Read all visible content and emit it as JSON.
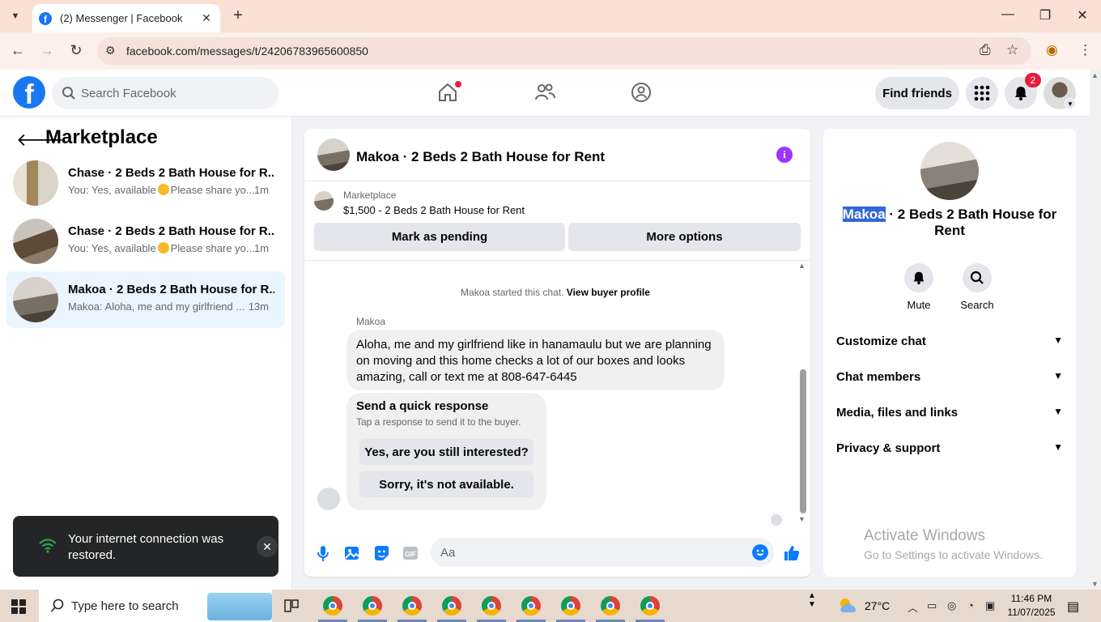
{
  "browser": {
    "tab_title": "(2) Messenger | Facebook",
    "url": "facebook.com/messages/t/24206783965600850"
  },
  "header": {
    "search_placeholder": "Search Facebook",
    "find_friends": "Find friends",
    "notification_count": "2"
  },
  "left_panel": {
    "title": "Marketplace",
    "conversations": [
      {
        "title": "Chase · 2 Beds 2 Bath House for R...",
        "preview_a": "You: Yes, available",
        "preview_b": "Please share yo...",
        "time": "1m"
      },
      {
        "title": "Chase · 2 Beds 2 Bath House for R...",
        "preview_a": "You: Yes, available",
        "preview_b": "Please share yo...",
        "time": "1m"
      },
      {
        "title": "Makoa · 2 Beds 2 Bath House for R...",
        "preview_a": "Makoa: Aloha, me and my girlfriend ...",
        "preview_b": "",
        "time": "13m"
      }
    ]
  },
  "toast": {
    "message": "Your internet connection was restored."
  },
  "chat": {
    "title": "Makoa · 2 Beds 2 Bath House for Rent",
    "marketplace_label": "Marketplace",
    "listing": "$1,500 - 2 Beds 2 Bath House for Rent",
    "mark_pending": "Mark as pending",
    "more_options": "More options",
    "started_text": "Makoa started this chat.",
    "view_profile": "View buyer profile",
    "sender": "Makoa",
    "message": "Aloha, me and my girlfriend like in hanamaulu but we are planning on moving and this home checks a lot of our boxes and looks amazing, call or text me at 808-647-6445",
    "quick_title": "Send a quick response",
    "quick_sub": "Tap a response to send it to the buyer.",
    "quick_1": "Yes, are you still interested?",
    "quick_2": "Sorry, it's not available.",
    "composer_placeholder": "Aa"
  },
  "right_panel": {
    "title_highlight": "Makoa",
    "title_rest": " · 2 Beds 2 Bath House for Rent",
    "mute": "Mute",
    "search": "Search",
    "sections": [
      "Customize chat",
      "Chat members",
      "Media, files and links",
      "Privacy & support"
    ],
    "watermark_1": "Activate Windows",
    "watermark_2": "Go to Settings to activate Windows."
  },
  "taskbar": {
    "search_placeholder": "Type here to search",
    "temperature": "27°C",
    "time": "11:46 PM",
    "date": "11/07/2025"
  },
  "colors": {
    "fb_blue": "#1877f2",
    "messenger_blue": "#0a7cff",
    "badge_red": "#e41e3f",
    "active_conv": "#ebf5ff",
    "info_purple": "#a033ff"
  }
}
